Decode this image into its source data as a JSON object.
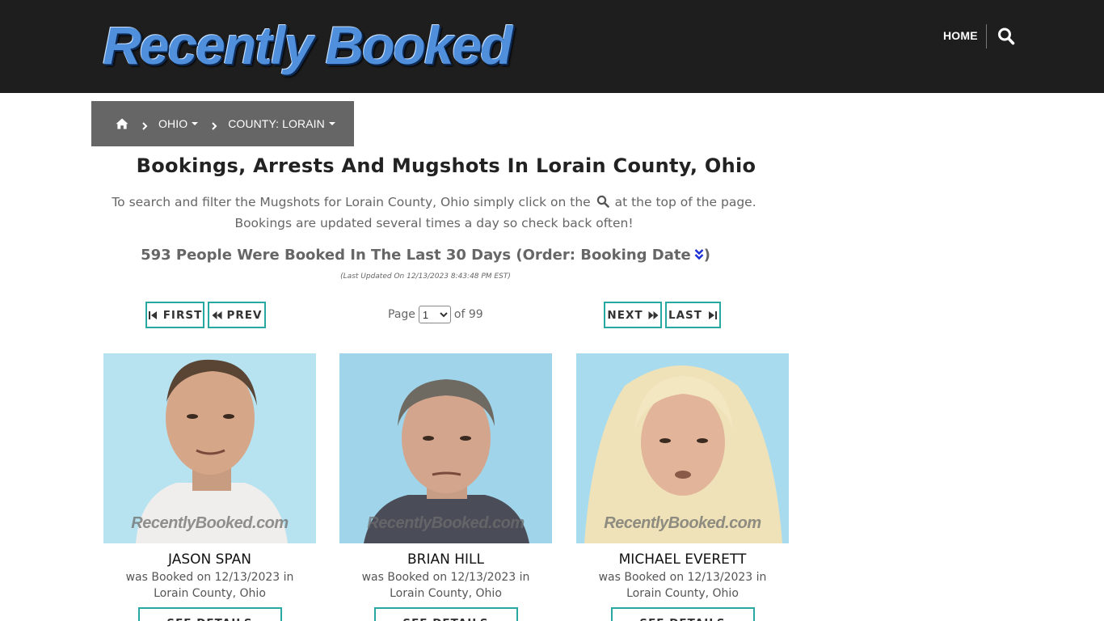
{
  "header": {
    "logo_text": "Recently Booked",
    "nav_home": "HOME",
    "search_icon": "magnifier-icon"
  },
  "breadcrumb": {
    "home_icon": "home-icon",
    "items": [
      {
        "label": "OHIO"
      },
      {
        "label": "COUNTY: LORAIN"
      }
    ]
  },
  "main": {
    "title": "Bookings, Arrests And Mugshots In Lorain County, Ohio",
    "intro_before": "To search and filter the Mugshots for Lorain County, Ohio simply click on the",
    "intro_after": "at the top of the page. Bookings are updated several times a day so check back often!",
    "count_text": "593 People Were Booked In The Last 30 Days (Order: Booking Date",
    "count_close": ")",
    "updated": "(Last Updated On 12/13/2023 8:43:48 PM EST)"
  },
  "pagination": {
    "first": "FIRST",
    "prev": "PREV",
    "next": "NEXT",
    "last": "LAST",
    "page_label": "Page",
    "current_page": "1",
    "of_label": "of 99"
  },
  "bookings": [
    {
      "name": "JASON SPAN",
      "booked_line1": "was Booked on 12/13/2023 in",
      "booked_line2": "Lorain County, Ohio",
      "details": "SEE DETAILS",
      "watermark": "RecentlyBooked.com"
    },
    {
      "name": "BRIAN HILL",
      "booked_line1": "was Booked on 12/13/2023 in",
      "booked_line2": "Lorain County, Ohio",
      "details": "SEE DETAILS",
      "watermark": "RecentlyBooked.com"
    },
    {
      "name": "MICHAEL EVERETT",
      "booked_line1": "was Booked on 12/13/2023 in",
      "booked_line2": "Lorain County, Ohio",
      "details": "SEE DETAILS",
      "watermark": "RecentlyBooked.com"
    }
  ],
  "colors": {
    "header_bg": "#1e1e1e",
    "breadcrumb_bg": "#666666",
    "button_border": "#27a8a0",
    "logo_blue": "#4f8fdc"
  }
}
